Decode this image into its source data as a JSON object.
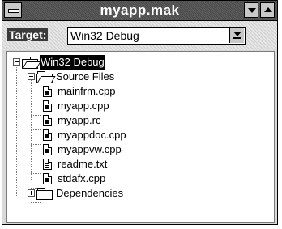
{
  "window": {
    "title": "myapp.mak"
  },
  "target": {
    "label": "Target:",
    "value": "Win32 Debug"
  },
  "tree": {
    "root": {
      "label": "Win32 Debug"
    },
    "source_folder": {
      "label": "Source Files"
    },
    "files": [
      {
        "label": "mainfrm.cpp"
      },
      {
        "label": "myapp.cpp"
      },
      {
        "label": "myapp.rc"
      },
      {
        "label": "myappdoc.cpp"
      },
      {
        "label": "myappvw.cpp"
      },
      {
        "label": "readme.txt"
      },
      {
        "label": "stdafx.cpp"
      }
    ],
    "dependencies": {
      "label": "Dependencies"
    }
  }
}
